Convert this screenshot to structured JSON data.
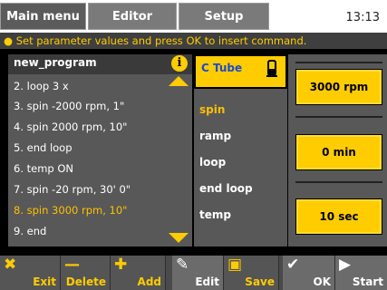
{
  "tabs": [
    {
      "label": "Main menu",
      "active": true
    },
    {
      "label": "Editor",
      "active": false
    },
    {
      "label": "Setup",
      "active": false
    }
  ],
  "clock": "13:13",
  "hint": "Set parameter values and press OK to insert command.",
  "program": {
    "name": "new_program",
    "steps": [
      {
        "text": "2. loop 3 x",
        "selected": false
      },
      {
        "text": "3. spin -2000 rpm, 1\"",
        "selected": false
      },
      {
        "text": "4. spin 2000 rpm, 10\"",
        "selected": false
      },
      {
        "text": "5. end loop",
        "selected": false
      },
      {
        "text": "6. temp ON",
        "selected": false
      },
      {
        "text": "7. spin -20 rpm, 30' 0\"",
        "selected": false
      },
      {
        "text": "8. spin 3000 rpm, 10\"",
        "selected": true
      },
      {
        "text": "9. end",
        "selected": false
      }
    ]
  },
  "commands": {
    "header": "C Tube",
    "items": [
      {
        "label": "spin",
        "selected": true
      },
      {
        "label": "ramp",
        "selected": false
      },
      {
        "label": "loop",
        "selected": false
      },
      {
        "label": "end loop",
        "selected": false
      },
      {
        "label": "temp",
        "selected": false
      }
    ]
  },
  "values": [
    "3000 rpm",
    "0 min",
    "10 sec"
  ],
  "toolbar": [
    {
      "label": "Exit",
      "icon": "x-icon",
      "glyph": "✖"
    },
    {
      "label": "Delete",
      "icon": "minus-icon",
      "glyph": "—"
    },
    {
      "label": "Add",
      "icon": "plus-icon",
      "glyph": "✚"
    },
    {
      "label": "Edit",
      "icon": "edit-icon",
      "glyph": "✎"
    },
    {
      "label": "Save",
      "icon": "save-icon",
      "glyph": "▣"
    },
    {
      "label": "OK",
      "icon": "check-icon",
      "glyph": "✔"
    },
    {
      "label": "Start",
      "icon": "play-icon",
      "glyph": "▶"
    }
  ],
  "colors": {
    "accent": "#ffcc00",
    "panel": "#585858",
    "header_text": "#1a4bd0"
  }
}
